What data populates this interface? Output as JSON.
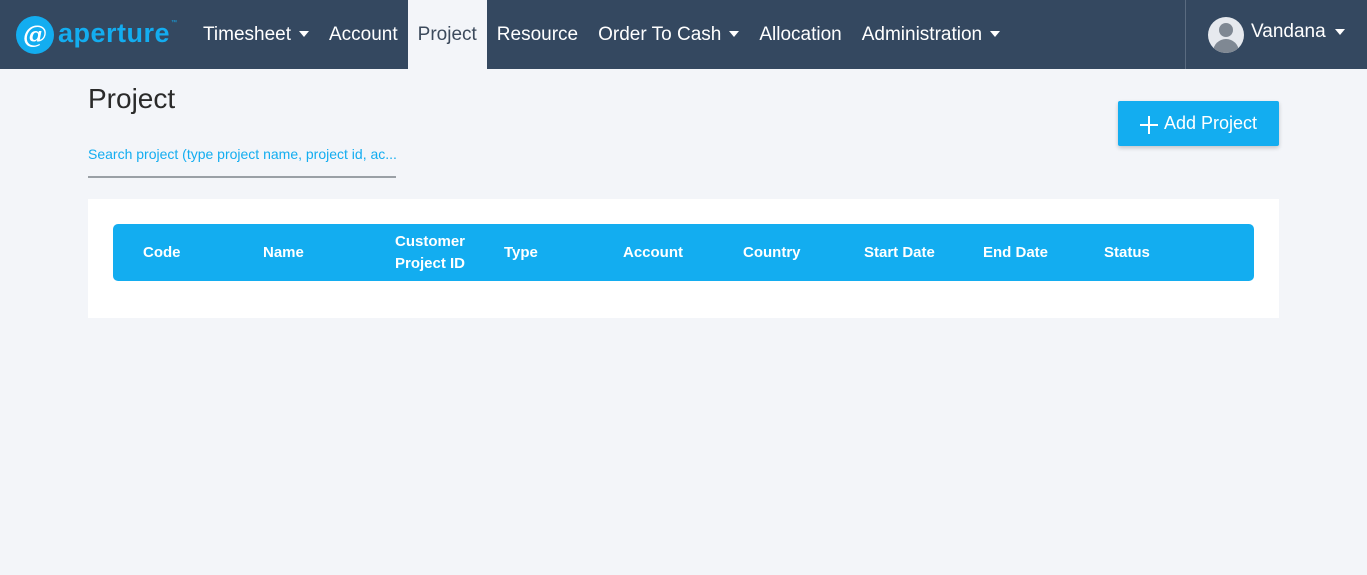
{
  "app": {
    "brand_name": "aperture",
    "brand_mark": "@",
    "brand_tm": "™"
  },
  "nav": {
    "items": [
      {
        "label": "Timesheet",
        "has_dropdown": true,
        "active": false
      },
      {
        "label": "Account",
        "has_dropdown": false,
        "active": false
      },
      {
        "label": "Project",
        "has_dropdown": false,
        "active": true
      },
      {
        "label": "Resource",
        "has_dropdown": false,
        "active": false
      },
      {
        "label": "Order To Cash",
        "has_dropdown": true,
        "active": false
      },
      {
        "label": "Allocation",
        "has_dropdown": false,
        "active": false
      },
      {
        "label": "Administration",
        "has_dropdown": true,
        "active": false
      }
    ]
  },
  "user": {
    "name": "Vandana",
    "avatar_icon": "user-avatar-icon"
  },
  "page": {
    "title": "Project",
    "search_placeholder": "Search project (type project name, project id, ac...",
    "add_button_label": "Add Project",
    "add_button_icon": "plus-icon"
  },
  "table": {
    "columns": [
      {
        "line1": "Code",
        "line2": ""
      },
      {
        "line1": "Name",
        "line2": ""
      },
      {
        "line1": "Customer",
        "line2": "Project ID"
      },
      {
        "line1": "Type",
        "line2": ""
      },
      {
        "line1": "Account",
        "line2": ""
      },
      {
        "line1": "Country",
        "line2": ""
      },
      {
        "line1": "Start Date",
        "line2": ""
      },
      {
        "line1": "End Date",
        "line2": ""
      },
      {
        "line1": "Status",
        "line2": ""
      }
    ],
    "rows": []
  },
  "colors": {
    "topbar": "#344860",
    "accent": "#13adf0",
    "page_bg": "#f3f5f9"
  }
}
